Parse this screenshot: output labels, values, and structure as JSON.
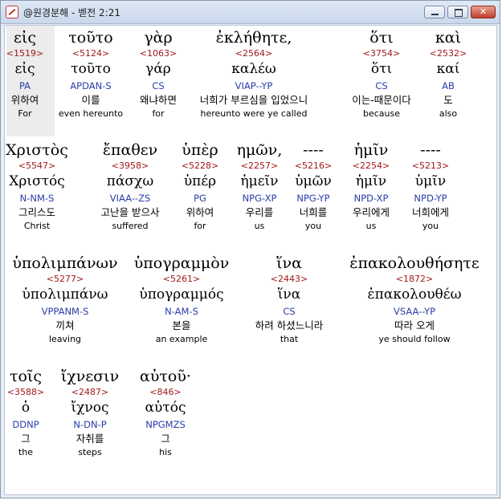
{
  "window": {
    "title": "@원경분해 - 벧전 2:21",
    "icon": "app-logo-icon"
  },
  "rows": [
    {
      "words": [
        {
          "greek": "εἰς",
          "strong": "<1519>",
          "lemma": "εἰς",
          "parse": "PA",
          "korean": "위하여",
          "english": "For"
        },
        {
          "greek": "τοῦτο",
          "strong": "<5124>",
          "lemma": "τοῦτο",
          "parse": "APDAN-S",
          "korean": "이를",
          "english": "even hereunto"
        },
        {
          "greek": "γὰρ",
          "strong": "<1063>",
          "lemma": "γάρ",
          "parse": "CS",
          "korean": "왜냐하면",
          "english": "for"
        },
        {
          "greek": "ἐκλήθητε,",
          "strong": "<2564>",
          "lemma": "καλέω",
          "parse": "VIAP--YP",
          "korean": "너희가 부르심을 입었으니",
          "english": "hereunto were ye called"
        },
        {
          "greek": "ὅτι",
          "strong": "<3754>",
          "lemma": "ὅτι",
          "parse": "CS",
          "korean": "이는-때문이다",
          "english": "because"
        },
        {
          "greek": "καὶ",
          "strong": "<2532>",
          "lemma": "καί",
          "parse": "AB",
          "korean": "도",
          "english": "also"
        }
      ]
    },
    {
      "words": [
        {
          "greek": "Χριστὸς",
          "strong": "<5547>",
          "lemma": "Χριστός",
          "parse": "N-NM-S",
          "korean": "그리스도",
          "english": "Christ"
        },
        {
          "greek": "ἔπαθεν",
          "strong": "<3958>",
          "lemma": "πάσχω",
          "parse": "VIAA--ZS",
          "korean": "고난을 받으사",
          "english": "suffered"
        },
        {
          "greek": "ὑπὲρ",
          "strong": "<5228>",
          "lemma": "ὑπέρ",
          "parse": "PG",
          "korean": "위하여",
          "english": "for"
        },
        {
          "greek": "ημῶν,",
          "strong": "<2257>",
          "lemma": "ἡμεῖν",
          "parse": "NPG-XP",
          "korean": "우리를",
          "english": "us"
        },
        {
          "greek": "----",
          "strong": "<5216>",
          "lemma": "ὑμῶν",
          "parse": "NPG-YP",
          "korean": "너희를",
          "english": "you"
        },
        {
          "greek": "ἡμῖν",
          "strong": "<2254>",
          "lemma": "ἡμῖν",
          "parse": "NPD-XP",
          "korean": "우리에게",
          "english": "us"
        },
        {
          "greek": "----",
          "strong": "<5213>",
          "lemma": "ὑμῖν",
          "parse": "NPD-YP",
          "korean": "너희에게",
          "english": "you"
        }
      ]
    },
    {
      "words": [
        {
          "greek": "ὑπολιμπάνων",
          "strong": "<5277>",
          "lemma": "ὑπολιμπάνω",
          "parse": "VPPANM-S",
          "korean": "끼쳐",
          "english": "leaving"
        },
        {
          "greek": "ὑπογραμμὸν",
          "strong": "<5261>",
          "lemma": "ὑπογραμμός",
          "parse": "N-AM-S",
          "korean": "본을",
          "english": "an example"
        },
        {
          "greek": "ἵνα",
          "strong": "<2443>",
          "lemma": "ἵνα",
          "parse": "CS",
          "korean": "하려 하셨느니라",
          "english": "that"
        },
        {
          "greek": "ἐπακολουθήσητε",
          "strong": "<1872>",
          "lemma": "ἐπακολουθέω",
          "parse": "VSAA--YP",
          "korean": "따라 오게",
          "english": "ye should follow"
        }
      ]
    },
    {
      "words": [
        {
          "greek": "τοῖς",
          "strong": "<3588>",
          "lemma": "ὁ",
          "parse": "DDNP",
          "korean": "그",
          "english": "the"
        },
        {
          "greek": "ἴχνεσιν",
          "strong": "<2487>",
          "lemma": "ἴχνος",
          "parse": "N-DN-P",
          "korean": "자취를",
          "english": "steps"
        },
        {
          "greek": "αὐτοῦ·",
          "strong": "<846>",
          "lemma": "αὐτός",
          "parse": "NPGMZS",
          "korean": "그",
          "english": "his"
        }
      ]
    }
  ]
}
